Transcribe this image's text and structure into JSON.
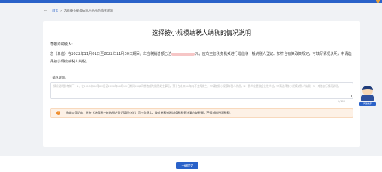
{
  "breadcrumb": {
    "back_label": "←",
    "home": "首页",
    "separator": ">",
    "current": "选择按小规模纳税人纳税的情况说明"
  },
  "page": {
    "title": "选择按小规模纳税人纳税的情况说明",
    "salutation": "尊敬的纳税人:",
    "paragraph_part1": "您（单位）在2022年11月01日至2022年11月30日期间，年应税销售额已达",
    "paragraph_part2": "元，应向主管税务机关进行增值税一般纳税人登记。如符合有关政策规定，可填写情况说明，申请选择按小规模纳税人纳税。"
  },
  "form": {
    "field_label": "情况说明:",
    "required_mark": "*",
    "placeholder": "情况说明参考如下：1、在2020年XX月XX日至20XX年XX月XX日期间XX公司销售额为偶然发生事项，预计在未来XX年内不会再发生，申请按照小规模纳税人纳税。2、我单位是非企业性单位，申请选择按小规模纳税人纳税。3、其他自行情况说明。",
    "char_count": "0/100"
  },
  "notice": {
    "icon": "info-icon",
    "text": "逾期未登记的，将按《增值税一般纳税人登记管理办法》第八条规定，按销售额依照增值税税率计算应纳税额，不得抵扣进项税额。"
  },
  "footer": {
    "submit_label": "一键提交"
  },
  "assistant": {
    "label": "问答助手"
  },
  "colors": {
    "primary": "#2a62c9",
    "notice_bg": "#fdf1e6",
    "notice_icon": "#ef8d2c",
    "required": "#e34d4d"
  }
}
